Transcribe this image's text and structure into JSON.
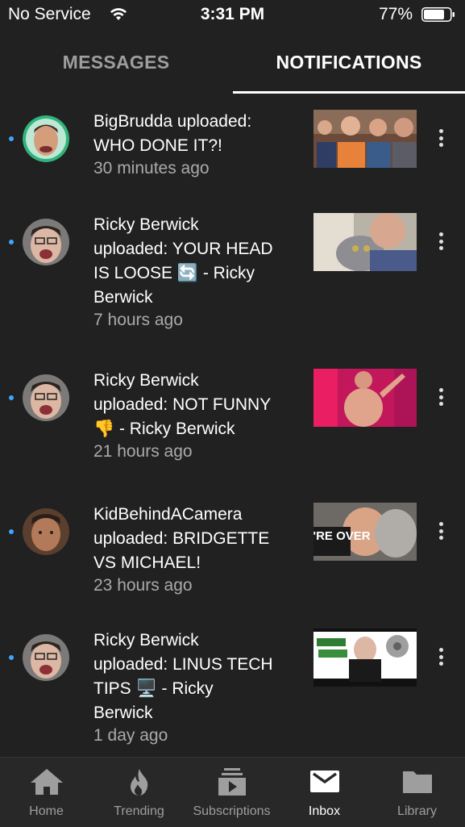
{
  "status": {
    "carrier": "No Service",
    "time": "3:31 PM",
    "battery": "77%"
  },
  "tabs": [
    {
      "label": "MESSAGES",
      "active": false
    },
    {
      "label": "NOTIFICATIONS",
      "active": true
    }
  ],
  "notifications": [
    {
      "line1": "BigBrudda uploaded:",
      "line2": "WHO DONE IT?!",
      "time": "30 minutes ago"
    },
    {
      "line1": "Ricky Berwick",
      "line2": "uploaded: YOUR HEAD",
      "line3": "IS LOOSE 🔄 - Ricky",
      "line4": "Berwick",
      "time": "7 hours ago"
    },
    {
      "line1": "Ricky Berwick",
      "line2": "uploaded: NOT FUNNY",
      "line3": "👎 - Ricky Berwick",
      "time": "21 hours ago"
    },
    {
      "line1": "KidBehindACamera",
      "line2": "uploaded: BRIDGETTE",
      "line3": "VS MICHAEL!",
      "time": "23 hours ago",
      "thumb_text": "WE'RE OVER"
    },
    {
      "line1": "Ricky Berwick",
      "line2": "uploaded: LINUS TECH",
      "line3": "TIPS 🖥️ - Ricky",
      "line4": "Berwick",
      "time": "1 day ago"
    }
  ],
  "nav": [
    {
      "label": "Home",
      "icon": "home-icon"
    },
    {
      "label": "Trending",
      "icon": "flame-icon"
    },
    {
      "label": "Subscriptions",
      "icon": "subscriptions-icon"
    },
    {
      "label": "Inbox",
      "icon": "inbox-icon",
      "active": true
    },
    {
      "label": "Library",
      "icon": "library-folder-icon"
    }
  ],
  "colors": {
    "background": "#212121",
    "unread_dot": "#3ea6ff",
    "nav_bg": "#282828"
  }
}
